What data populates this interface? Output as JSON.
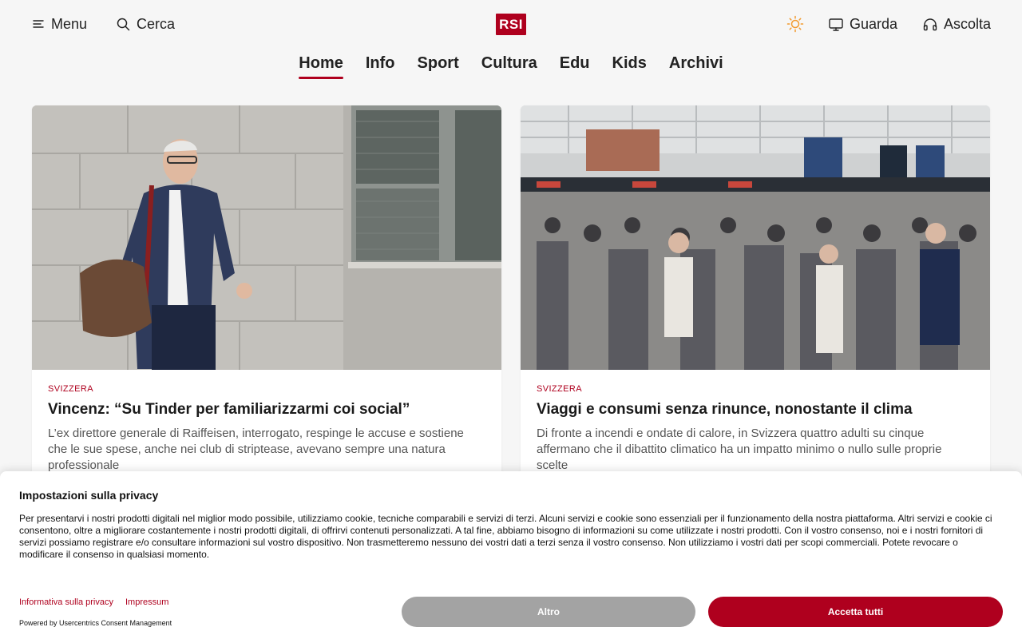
{
  "header": {
    "menu_label": "Menu",
    "search_label": "Cerca",
    "logo_text": "RSI",
    "watch_label": "Guarda",
    "listen_label": "Ascolta"
  },
  "nav": {
    "items": [
      {
        "label": "Home",
        "active": true
      },
      {
        "label": "Info"
      },
      {
        "label": "Sport"
      },
      {
        "label": "Cultura"
      },
      {
        "label": "Edu"
      },
      {
        "label": "Kids"
      },
      {
        "label": "Archivi"
      }
    ]
  },
  "cards": [
    {
      "kicker": "SVIZZERA",
      "title": "Vincenz: “Su Tinder per familiarizzarmi coi social”",
      "lead": "L’ex direttore generale di Raiffeisen, interrogato, respinge le accuse e sostiene che le sue spese, anche nei club di striptease, avevano sempre una natura professionale"
    },
    {
      "kicker": "SVIZZERA",
      "title": "Viaggi e consumi senza rinunce, nonostante il clima",
      "lead": "Di fronte a incendi e ondate di calore, in Svizzera quattro adulti su cinque affermano che il dibattito climatico ha un impatto minimo o nullo sulle proprie scelte"
    }
  ],
  "consent": {
    "title": "Impostazioni sulla privacy",
    "text": "Per presentarvi i nostri prodotti digitali nel miglior modo possibile, utilizziamo cookie, tecniche comparabili e servizi di terzi. Alcuni servizi e cookie sono essenziali per il funzionamento della nostra piattaforma. Altri servizi e cookie ci consentono, oltre a migliorare costantemente i nostri prodotti digitali, di offrirvi contenuti personalizzati. A tal fine, abbiamo bisogno di informazioni su come utilizzate i nostri prodotti. Con il vostro consenso, noi e i nostri fornitori di servizi possiamo registrare e/o consultare informazioni sul vostro dispositivo. Non trasmetteremo nessuno dei vostri dati a terzi senza il vostro consenso. Non utilizziamo i vostri dati per scopi commerciali. Potete revocare o modificare il consenso in qualsiasi momento.",
    "privacy_link": "Informativa sulla privacy",
    "impressum_link": "Impressum",
    "powered_by": "Powered by Usercentrics Consent Management",
    "more_button": "Altro",
    "accept_button": "Accetta tutti"
  },
  "colors": {
    "brand_red": "#af001e",
    "sun_orange": "#f29a2e",
    "button_grey": "#a3a3a3"
  }
}
